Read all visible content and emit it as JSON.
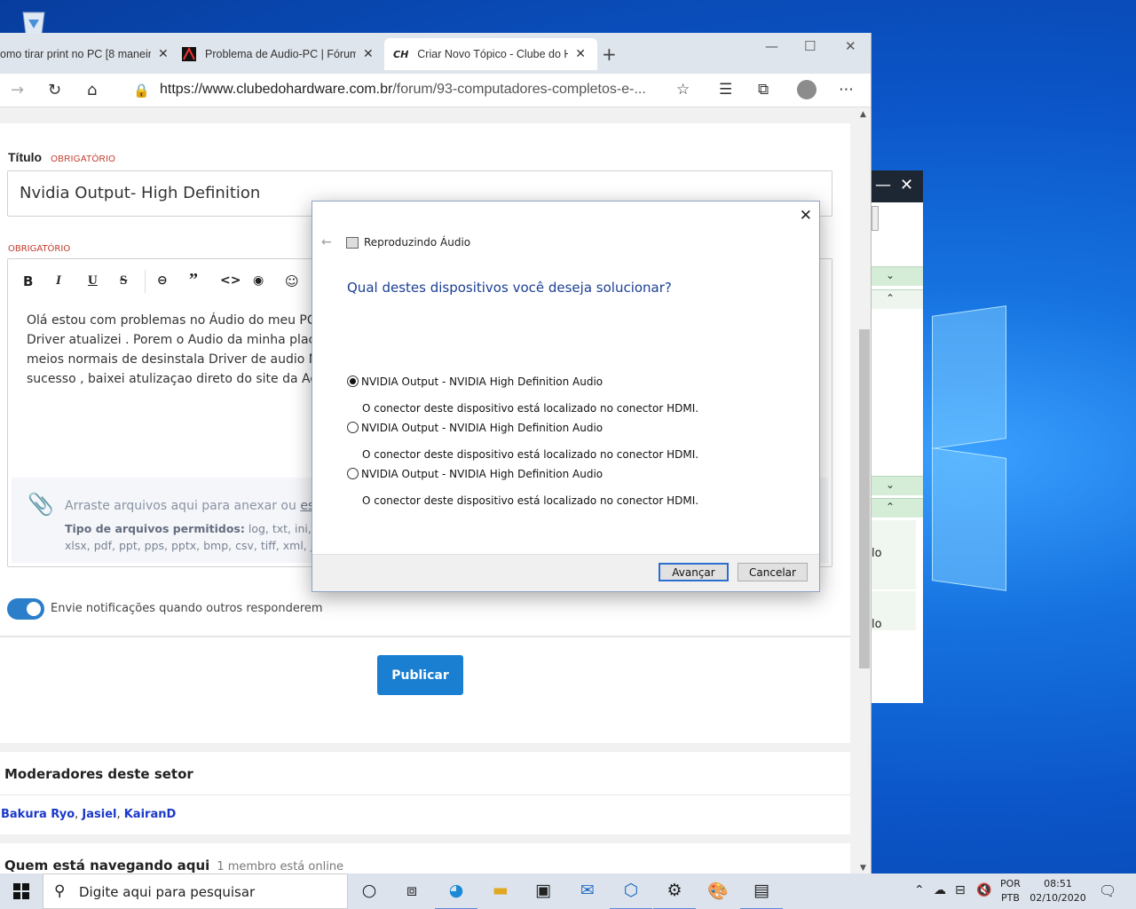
{
  "browser": {
    "tabs": [
      {
        "title": "omo tirar print no PC [8 maneir",
        "active": false
      },
      {
        "title": "Problema de Audio-PC | Fórum A",
        "active": false
      },
      {
        "title": "Criar Novo Tópico - Clube do Ha",
        "active": true
      }
    ],
    "url_host": "https://www.clubedohardware.com.br",
    "url_path": "/forum/93-computadores-completos-e-..."
  },
  "form": {
    "title_label": "Título",
    "required_label": "OBRIGATÓRIO",
    "title_value": "Nvidia Output- High Definition",
    "body_required_label": "OBRIGATÓRIO",
    "body_lines": [
      "Olá estou com problemas no Áudio do meu PC ,a",
      "Driver atualizei . Porem o Audio da minha placa m",
      "meios normais de desinstala Driver de audio Nvid",
      "sucesso , baixei atulizaçao direto do site da Aoru"
    ],
    "attach_text": "Arraste arquivos aqui para anexar ou ",
    "attach_link": "escolh",
    "allowed_label": "Tipo de arquivos permitidos:",
    "allowed_types_1": " log, txt, ini, zip, ",
    "allowed_types_2": "xlsx, pdf, ppt, pps, pptx, bmp, csv, tiff, xml, jpe",
    "notify_label": "Envie notificações quando outros responderem",
    "publish_label": "Publicar"
  },
  "moderators": {
    "title": "Moderadores deste setor",
    "names": [
      "Bakura Ryo",
      "Jasiel",
      "KairanD"
    ]
  },
  "browsing": {
    "title": "Quem está navegando aqui",
    "count": "1 membro está online"
  },
  "dialog": {
    "app_title": "Reproduzindo Áudio",
    "question": "Qual destes dispositivos você deseja solucionar?",
    "options": [
      {
        "label": "NVIDIA Output - NVIDIA High Definition Audio",
        "desc": "O conector deste dispositivo está localizado no conector HDMI.",
        "selected": true
      },
      {
        "label": "NVIDIA Output - NVIDIA High Definition Audio",
        "desc": "O conector deste dispositivo está localizado no conector HDMI.",
        "selected": false
      },
      {
        "label": "NVIDIA Output - NVIDIA High Definition Audio",
        "desc": "O conector deste dispositivo está localizado no conector HDMI.",
        "selected": false
      }
    ],
    "next_label": "Avançar",
    "cancel_label": "Cancelar"
  },
  "taskbar": {
    "search_placeholder": "Digite aqui para pesquisar",
    "lang_1": "POR",
    "lang_2": "PTB",
    "time": "08:51",
    "date": "02/10/2020"
  },
  "bgwin": {
    "label_1": "lo",
    "label_2": "lo"
  }
}
